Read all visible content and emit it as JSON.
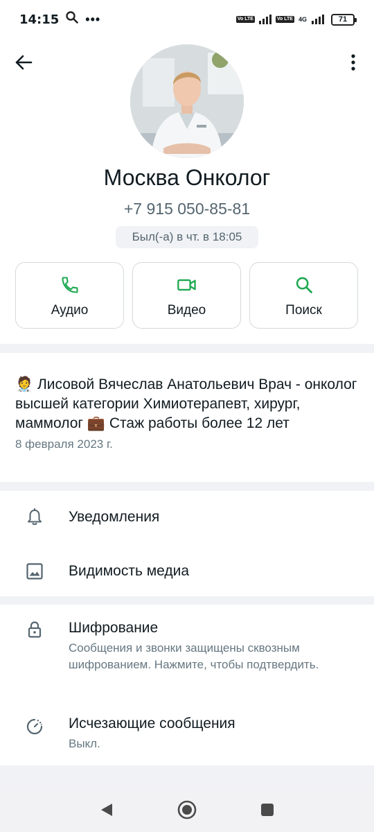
{
  "status_bar": {
    "time": "14:15",
    "network_label": "4G",
    "volte_label": "Vo LTE",
    "battery": "71",
    "icons": [
      "search-icon",
      "more-dots-icon",
      "volte-icon",
      "signal-icon",
      "battery-icon"
    ]
  },
  "header": {
    "contact_name": "Москва Онколог",
    "phone": "+7 915 050-85-81",
    "last_seen": "Был(-а) в чт. в 18:05",
    "icons": [
      "back-arrow-icon",
      "more-vertical-icon"
    ]
  },
  "actions": [
    {
      "label": "Аудио",
      "icon": "phone-icon"
    },
    {
      "label": "Видео",
      "icon": "video-icon"
    },
    {
      "label": "Поиск",
      "icon": "search-icon"
    }
  ],
  "about": {
    "text": "🧑‍⚕️ Лисовой Вячеслав Анатольевич Врач - онколог высшей категории Химиотерапевт, хирург, маммолог 💼 Стаж работы более 12 лет",
    "date": "8 февраля 2023 г."
  },
  "settings": {
    "notifications": {
      "title": "Уведомления",
      "icon": "bell-icon"
    },
    "media_visibility": {
      "title": "Видимость медиа",
      "icon": "image-icon"
    },
    "encryption": {
      "title": "Шифрование",
      "subtitle": "Сообщения и звонки защищены сквозным шифрованием. Нажмите, чтобы подтвердить.",
      "icon": "lock-icon"
    },
    "disappearing": {
      "title": "Исчезающие сообщения",
      "subtitle": "Выкл.",
      "icon": "timer-icon"
    }
  },
  "colors": {
    "accent_green": "#1DA851",
    "icon_gray": "#54656f",
    "background": "#f0f2f5"
  },
  "nav_bar": {
    "icons": [
      "back-triangle-icon",
      "home-circle-icon",
      "recents-square-icon"
    ]
  }
}
